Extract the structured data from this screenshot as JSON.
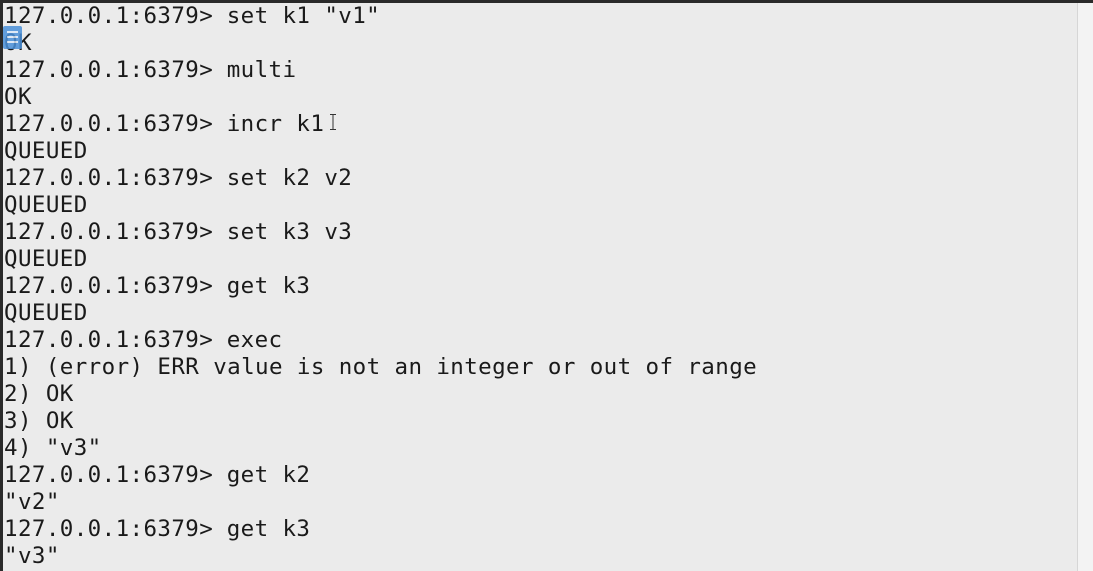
{
  "terminal": {
    "prompt": "127.0.0.1:6379>",
    "lines": [
      {
        "type": "cmd",
        "text": "set k1 \"v1\""
      },
      {
        "type": "out",
        "text": "OK"
      },
      {
        "type": "cmd",
        "text": "multi"
      },
      {
        "type": "out",
        "text": "OK"
      },
      {
        "type": "cmd",
        "text": "incr k1"
      },
      {
        "type": "out",
        "text": "QUEUED"
      },
      {
        "type": "cmd",
        "text": "set k2 v2"
      },
      {
        "type": "out",
        "text": "QUEUED"
      },
      {
        "type": "cmd",
        "text": "set k3 v3"
      },
      {
        "type": "out",
        "text": "QUEUED"
      },
      {
        "type": "cmd",
        "text": "get k3"
      },
      {
        "type": "out",
        "text": "QUEUED"
      },
      {
        "type": "cmd",
        "text": "exec"
      },
      {
        "type": "out",
        "text": "1) (error) ERR value is not an integer or out of range"
      },
      {
        "type": "out",
        "text": "2) OK"
      },
      {
        "type": "out",
        "text": "3) OK"
      },
      {
        "type": "out",
        "text": "4) \"v3\""
      },
      {
        "type": "cmd",
        "text": "get k2"
      },
      {
        "type": "out",
        "text": "\"v2\""
      },
      {
        "type": "cmd",
        "text": "get k3"
      },
      {
        "type": "out",
        "text": "\"v3\""
      }
    ]
  },
  "icons": {
    "marker": "selection-marker-icon",
    "cursor": "ibeam-cursor-icon"
  },
  "colors": {
    "background": "#ebebeb",
    "text": "#1a1a1a",
    "marker": "#4a90d9"
  }
}
